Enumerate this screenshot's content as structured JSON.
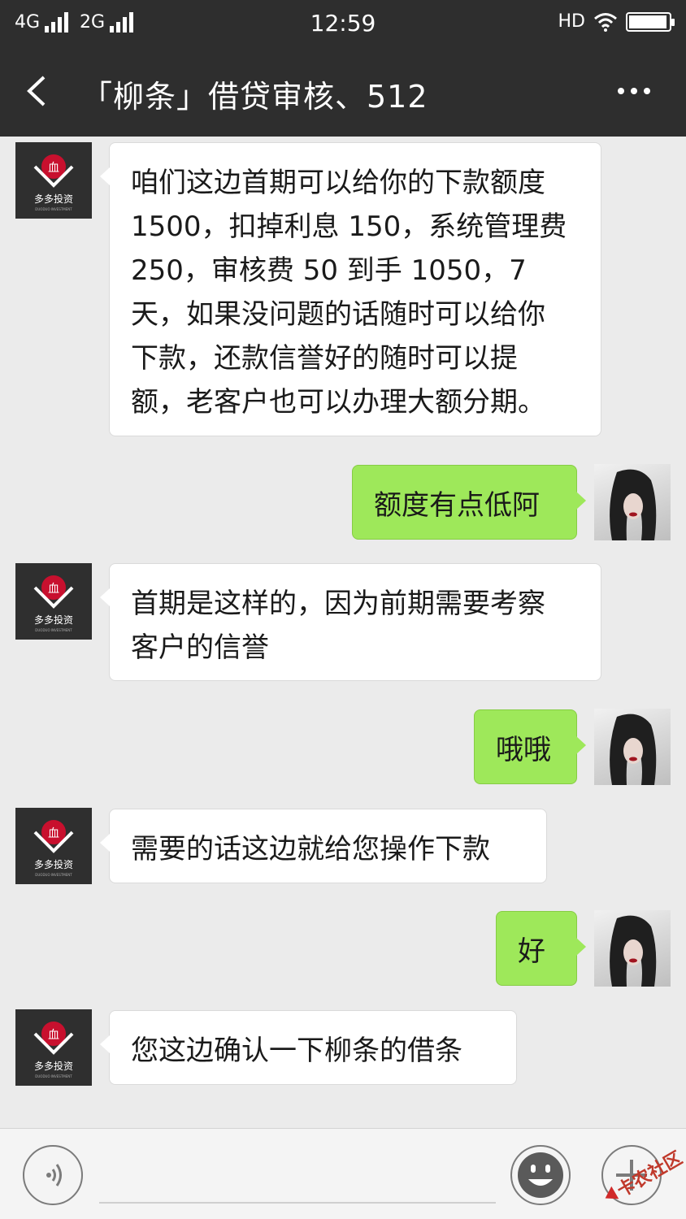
{
  "status_bar": {
    "network_1": "4G",
    "network_2": "2G",
    "time": "12:59",
    "hd": "HD",
    "battery_level": 0.95
  },
  "header": {
    "title": "「柳条」借贷审核、512",
    "back_icon": "chevron-left-icon",
    "more_icon": "more-dots-icon"
  },
  "messages": [
    {
      "side": "left",
      "lines": [
        "咱们这边首期可以给你的下款额度",
        "1500，扣掉利息 150，系统管理费",
        "250，审核费 50  到手 1050，7",
        "天，如果没问题的话随时可以给你",
        "下款，还款信誉好的随时可以提",
        "额，老客户也可以办理大额分期。"
      ]
    },
    {
      "side": "right",
      "lines": [
        "额度有点低阿"
      ]
    },
    {
      "side": "left",
      "lines": [
        "首期是这样的，因为前期需要考察",
        "客户的信誉"
      ]
    },
    {
      "side": "right",
      "lines": [
        "哦哦"
      ]
    },
    {
      "side": "left",
      "lines": [
        "需要的话这边就给您操作下款"
      ]
    },
    {
      "side": "right",
      "lines": [
        "好"
      ]
    },
    {
      "side": "left",
      "lines": [
        "您这边确认一下柳条的借条"
      ]
    }
  ],
  "avatar": {
    "company_logo_text": "多多投资",
    "company_logo_subtext": "DUODUO INVESTMENT"
  },
  "input_bar": {
    "voice_icon": "voice-icon",
    "emoji_icon": "emoji-icon",
    "plus_icon": "plus-icon"
  },
  "watermark": {
    "text": "卡农社区"
  },
  "colors": {
    "header_bg": "#2e2e2e",
    "chat_bg": "#ebebeb",
    "bubble_right": "#9ee85a",
    "bubble_left": "#ffffff"
  }
}
